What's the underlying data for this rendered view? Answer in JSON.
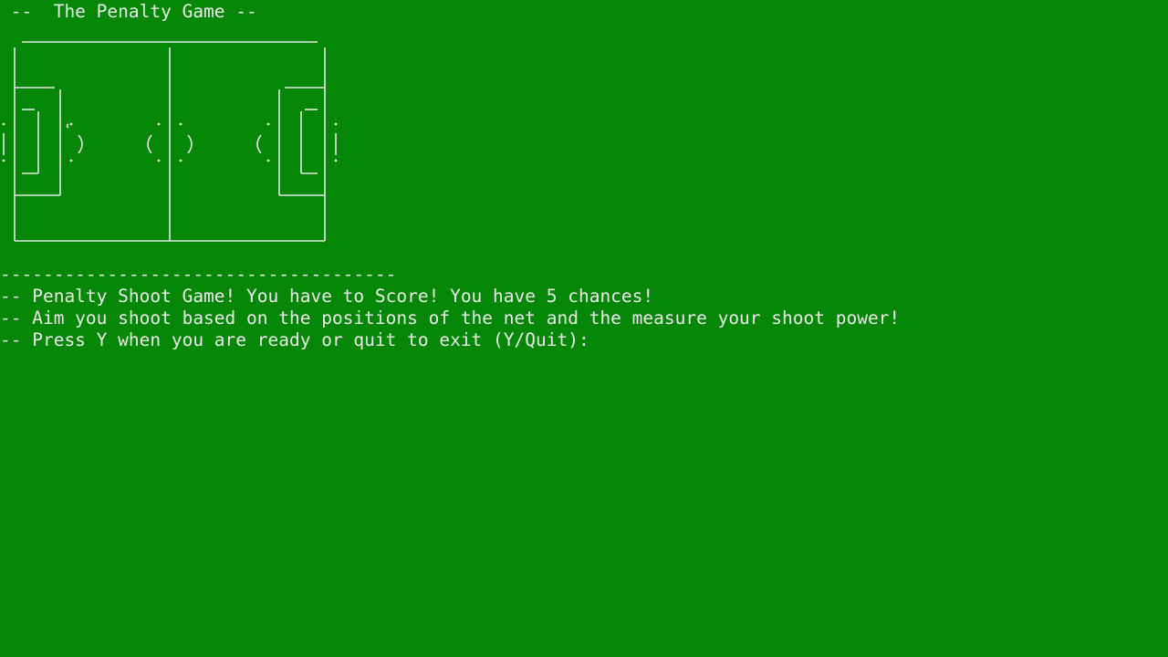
{
  "console": {
    "title": " --  The Penalty Game --",
    "separator": "-------------------------------------",
    "lines": [
      "-- Penalty Shoot Game! You have to Score! You have 5 chances!",
      "-- Aim you shoot based on the positions of the net and the measure your shoot power!",
      "-- Press Y when you are ready or quit to exit (Y/Quit):"
    ]
  },
  "pitch_art": {
    "icon": "football-pitch-ascii-art"
  },
  "colors": {
    "background": "#078707",
    "text": "#eaeaea"
  }
}
